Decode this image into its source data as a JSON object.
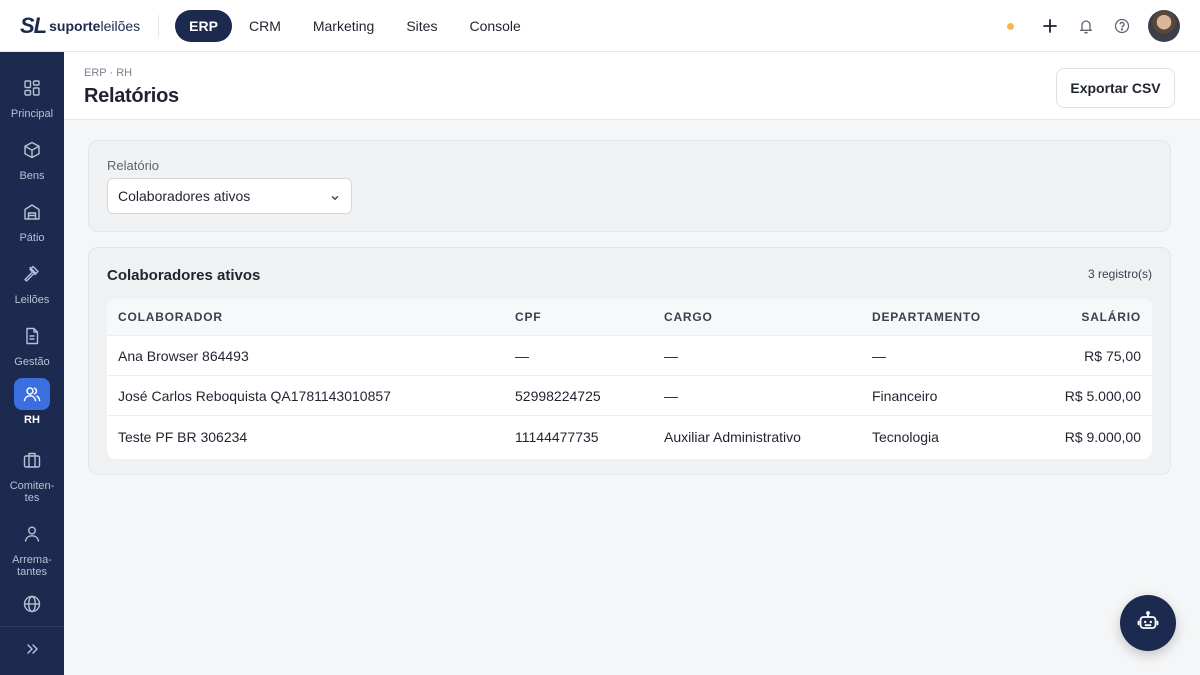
{
  "brand": {
    "mark": "SL",
    "name_bold": "suporte",
    "name_light": "leilões"
  },
  "topnav": {
    "tabs": [
      {
        "label": "ERP",
        "active": true
      },
      {
        "label": "CRM",
        "active": false
      },
      {
        "label": "Marketing",
        "active": false
      },
      {
        "label": "Sites",
        "active": false
      },
      {
        "label": "Console",
        "active": false
      }
    ],
    "status_color": "#f5b94a",
    "icons": [
      "plus-icon",
      "bell-icon",
      "help-icon"
    ]
  },
  "sidebar": {
    "items": [
      {
        "label": "Principal",
        "icon": "dashboard-icon"
      },
      {
        "label": "Bens",
        "icon": "box-icon"
      },
      {
        "label": "Pátio",
        "icon": "warehouse-icon"
      },
      {
        "label": "Leilões",
        "icon": "gavel-icon"
      },
      {
        "label": "Gestão",
        "icon": "document-icon"
      },
      {
        "label": "RH",
        "icon": "users-icon",
        "active": true
      },
      {
        "label": "Comiten-tes",
        "label_lines": [
          "Comiten-",
          "tes"
        ],
        "icon": "briefcase-icon"
      },
      {
        "label": "Arrema-tantes",
        "label_lines": [
          "Arrema-",
          "tantes"
        ],
        "icon": "user-icon"
      },
      {
        "label": "",
        "icon": "globe-icon"
      }
    ],
    "footer_icon": "chevrons-right-icon"
  },
  "page": {
    "breadcrumb": "ERP · RH",
    "title": "Relatórios",
    "export_label": "Exportar CSV"
  },
  "filter": {
    "label": "Relatório",
    "selected": "Colaboradores ativos"
  },
  "results": {
    "title": "Colaboradores ativos",
    "count": "3 registro(s)",
    "columns": [
      "COLABORADOR",
      "CPF",
      "CARGO",
      "DEPARTAMENTO",
      "SALÁRIO"
    ],
    "rows": [
      [
        "Ana Browser 864493",
        "—",
        "—",
        "—",
        "R$ 75,00"
      ],
      [
        "José Carlos Reboquista QA1781143010857",
        "52998224725",
        "—",
        "Financeiro",
        "R$ 5.000,00"
      ],
      [
        "Teste PF BR 306234",
        "11144477735",
        "Auxiliar Administrativo",
        "Tecnologia",
        "R$ 9.000,00"
      ]
    ]
  },
  "colors": {
    "navy": "#1b2a4e",
    "accent": "#3b6fe0"
  }
}
